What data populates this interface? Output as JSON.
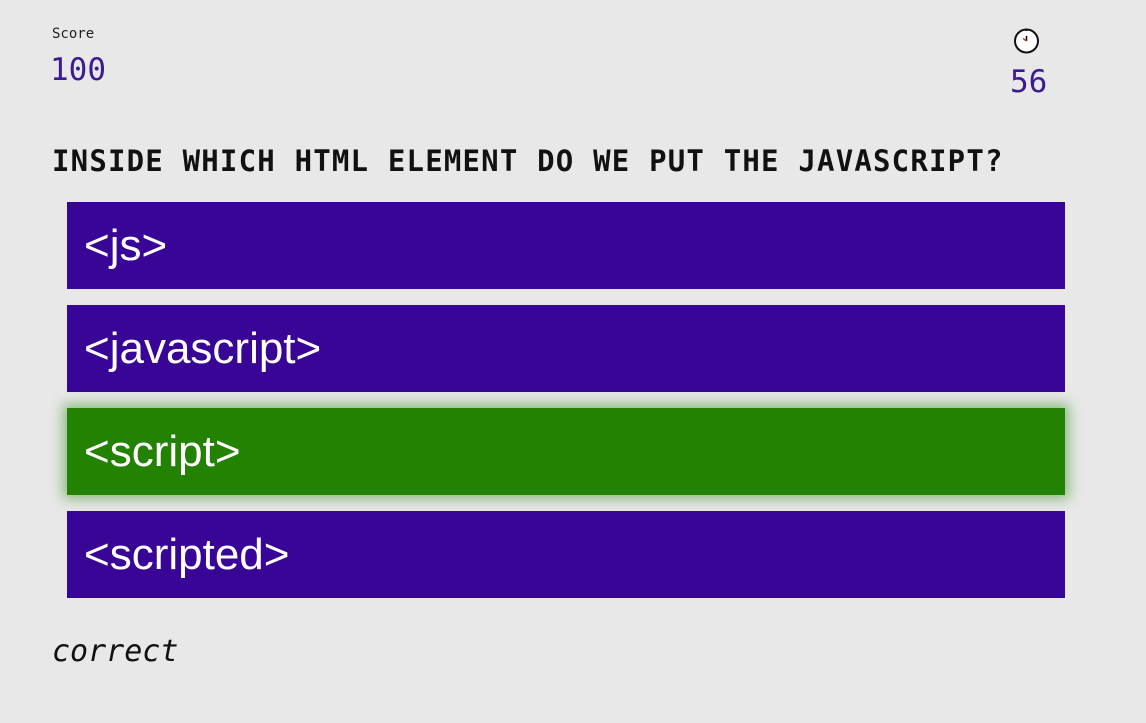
{
  "score": {
    "label": "Score",
    "value": "100"
  },
  "timer": {
    "icon": "stopwatch-icon",
    "value": "56"
  },
  "question": {
    "text": "INSIDE WHICH HTML ELEMENT DO WE PUT THE JAVASCRIPT?"
  },
  "answers": [
    {
      "label": "<js>",
      "state": "default"
    },
    {
      "label": "<javascript>",
      "state": "default"
    },
    {
      "label": "<script>",
      "state": "correct"
    },
    {
      "label": "<scripted>",
      "state": "default"
    }
  ],
  "feedback": {
    "text": "correct"
  },
  "colors": {
    "background": "#e8e8e8",
    "answer_default": "#380596",
    "answer_correct": "#248202",
    "accent_text": "#3b1a93"
  }
}
